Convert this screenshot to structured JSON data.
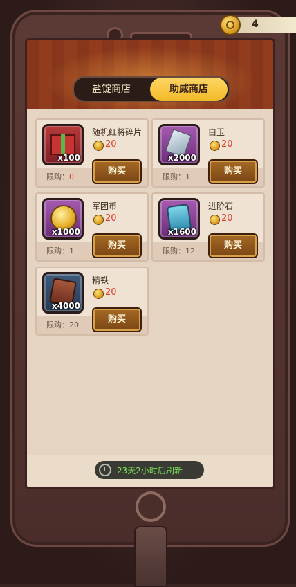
{
  "currency": {
    "icon": "gold-coin-icon",
    "value": "4"
  },
  "tabs": [
    {
      "label": "盐锭商店",
      "active": false
    },
    {
      "label": "助威商店",
      "active": true
    }
  ],
  "items": [
    {
      "name": "随机红将碎片",
      "quantity": "x100",
      "price": "20",
      "limit_label": "限购：",
      "limit_value": "0",
      "buy_label": "购买",
      "icon": "red-gift-box-icon"
    },
    {
      "name": "白玉",
      "quantity": "x2000",
      "price": "20",
      "limit_label": "限购：",
      "limit_value": "1",
      "buy_label": "购买",
      "icon": "white-jade-icon"
    },
    {
      "name": "军团币",
      "quantity": "x1000",
      "price": "20",
      "limit_label": "限购：",
      "limit_value": "1",
      "buy_label": "购买",
      "icon": "legion-coin-icon"
    },
    {
      "name": "进阶石",
      "quantity": "x1600",
      "price": "20",
      "limit_label": "限购：",
      "limit_value": "12",
      "buy_label": "购买",
      "icon": "advance-stone-icon"
    },
    {
      "name": "精铁",
      "quantity": "x4000",
      "price": "20",
      "limit_label": "限购：",
      "limit_value": "20",
      "buy_label": "购买",
      "icon": "refined-iron-icon"
    }
  ],
  "refresh_text": "23天2小时后刷新",
  "colors": {
    "accent": "#f2b927",
    "price_red": "#e23a2a",
    "refresh_green": "#7be25a"
  }
}
